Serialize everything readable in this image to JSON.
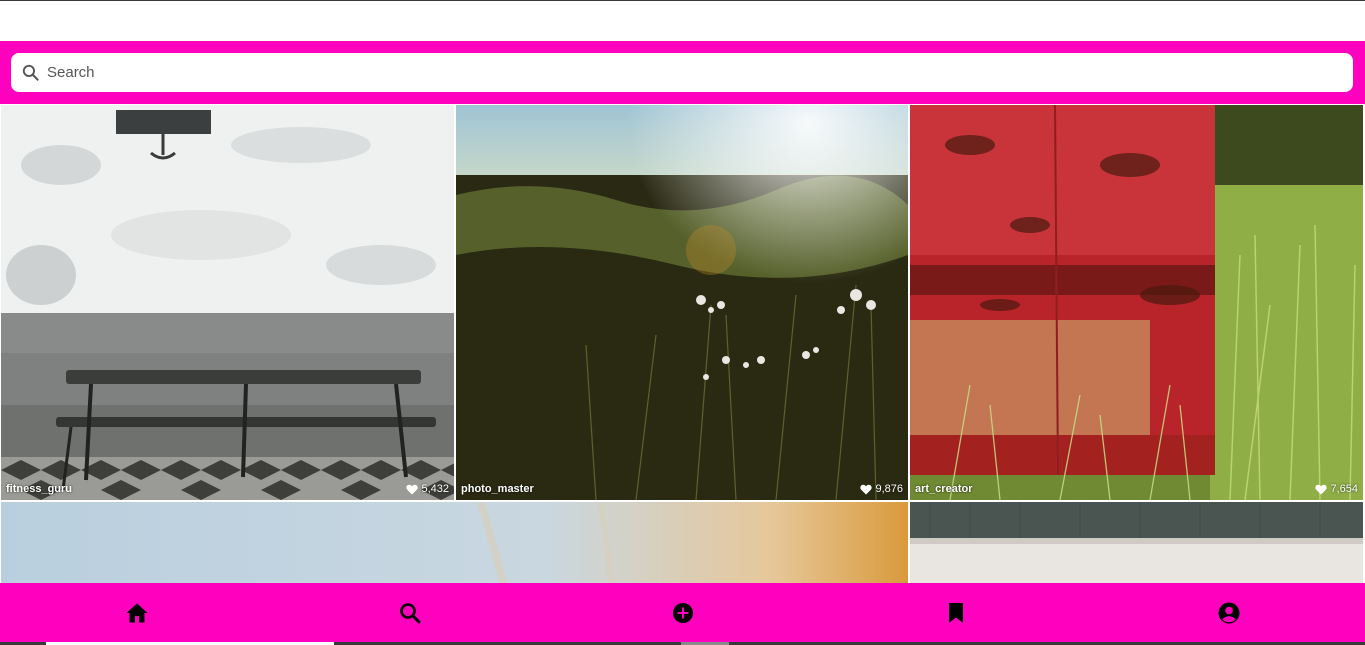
{
  "search": {
    "placeholder": "Search",
    "icon": "search-icon"
  },
  "posts": [
    {
      "user": "fitness_guru",
      "likes": "5,432",
      "scene": "white wall with bench and anchor sign"
    },
    {
      "user": "photo_master",
      "likes": "9,876",
      "scene": "wildflowers in dark grass at sunset"
    },
    {
      "user": "art_creator",
      "likes": "7,654",
      "scene": "rusty red barrel beside grass"
    },
    {
      "user": "",
      "likes": "",
      "scene": "blurred sky with warm light"
    },
    {
      "user": "",
      "likes": "",
      "scene": "grey panel over light background"
    }
  ],
  "nav": {
    "items": [
      {
        "icon": "home-icon"
      },
      {
        "icon": "search-icon"
      },
      {
        "icon": "add-circle-icon"
      },
      {
        "icon": "bookmark-icon"
      },
      {
        "icon": "profile-icon"
      }
    ]
  },
  "colors": {
    "accent": "#ff00bf",
    "nav_icon": "#000000"
  }
}
